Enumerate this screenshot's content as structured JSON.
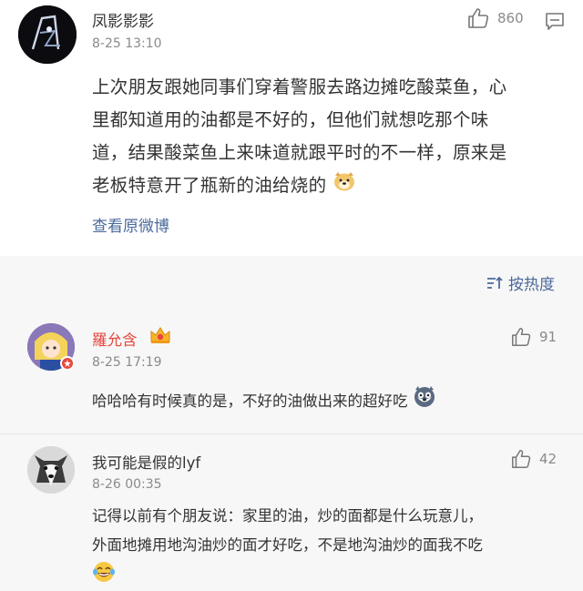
{
  "post": {
    "author": "凤影影影",
    "time": "8-25 13:10",
    "likes": "860",
    "lines": [
      "上次朋友跟她同事们穿着警服去路边摊吃酸菜鱼，心",
      "里都知道用的油都是不好的，但他们就想吃那个味",
      "道，结果酸菜鱼上来味道就跟平时的不一样，原来是",
      "老板特意开了瓶新的油给烧的"
    ],
    "view_original": "查看原微博",
    "end_emoji": "doge-emoji"
  },
  "sort": {
    "label": "按热度",
    "icon": "sort-icon"
  },
  "comments": [
    {
      "author": "羅允含",
      "time": "8-25 17:19",
      "likes": "91",
      "text": "哈哈哈有时候真的是，不好的油做出来的超好吃",
      "badge": "crown-badge",
      "emoji": "husky-emoji"
    },
    {
      "author": "我可能是假的lyf",
      "time": "8-26 00:35",
      "likes": "42",
      "lines": [
        "记得以前有个朋友说：家里的油，炒的面都是什么玩意儿，",
        "外面地摊用地沟油炒的面才好吃，不是地沟油炒的面我不吃"
      ],
      "emoji": "laugh-cry-emoji"
    }
  ],
  "colors": {
    "link": "#4a6a9c",
    "badge_red": "#e8453c",
    "muted": "#8a8a8a",
    "comment_bg": "#f7f7f7"
  }
}
